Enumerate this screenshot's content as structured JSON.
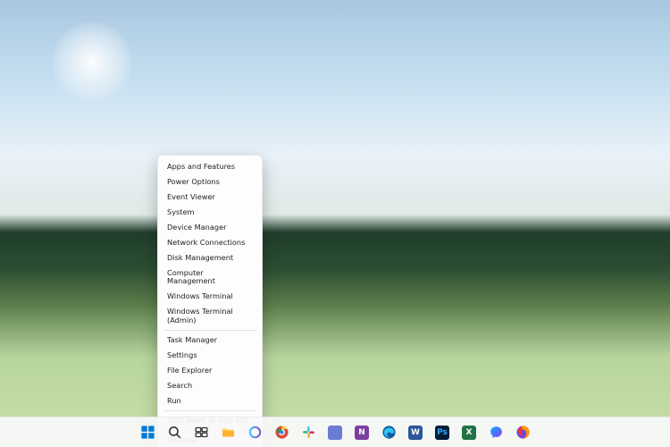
{
  "context_menu": {
    "groups": [
      [
        "Apps and Features",
        "Power Options",
        "Event Viewer",
        "System",
        "Device Manager",
        "Network Connections",
        "Disk Management",
        "Computer Management",
        "Windows Terminal",
        "Windows Terminal (Admin)"
      ],
      [
        "Task Manager",
        "Settings",
        "File Explorer",
        "Search",
        "Run"
      ],
      [
        "Shut down or sign out"
      ],
      [
        "Desktop"
      ]
    ],
    "submenu_items": [
      "Shut down or sign out"
    ]
  },
  "taskbar": {
    "icons": [
      {
        "name": "start-icon",
        "label": "Start"
      },
      {
        "name": "search-icon",
        "label": "Search"
      },
      {
        "name": "task-view-icon",
        "label": "Task View"
      },
      {
        "name": "file-explorer-icon",
        "label": "File Explorer"
      },
      {
        "name": "cortana-icon",
        "label": "Cortana"
      },
      {
        "name": "chrome-icon",
        "label": "Chrome"
      },
      {
        "name": "slack-icon",
        "label": "Slack"
      },
      {
        "name": "app-icon-1",
        "label": "App"
      },
      {
        "name": "onenote-icon",
        "label": "OneNote"
      },
      {
        "name": "edge-icon",
        "label": "Edge"
      },
      {
        "name": "word-icon",
        "label": "Word"
      },
      {
        "name": "photoshop-icon",
        "label": "Photoshop"
      },
      {
        "name": "excel-icon",
        "label": "Excel"
      },
      {
        "name": "messenger-icon",
        "label": "Messenger"
      },
      {
        "name": "firefox-icon",
        "label": "Firefox"
      }
    ]
  }
}
